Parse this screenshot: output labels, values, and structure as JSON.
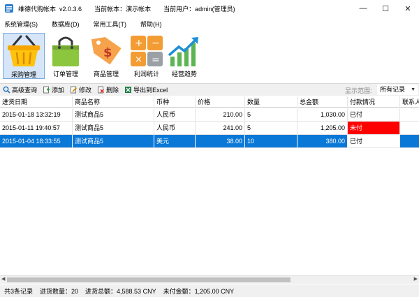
{
  "window": {
    "app_name": "维德代购帐本",
    "version": "v2.0.3.6",
    "current_book": "当前帐本：演示帐本",
    "current_user": "当前用户：admin(管理员)",
    "minimize": "—",
    "maximize": "☐",
    "close": "✕"
  },
  "menu": [
    "系统管理(S)",
    "数据库(D)",
    "常用工具(T)",
    "帮助(H)"
  ],
  "toolbar": [
    {
      "label": "采购管理",
      "icon": "shopping-basket-icon",
      "active": true
    },
    {
      "label": "订单管理",
      "icon": "shopping-bag-icon",
      "active": false
    },
    {
      "label": "商品管理",
      "icon": "price-tag-icon",
      "active": false
    },
    {
      "label": "利润统计",
      "icon": "calculator-icon",
      "active": false
    },
    {
      "label": "经营趋势",
      "icon": "trend-chart-icon",
      "active": false
    }
  ],
  "actions": {
    "search": "高级查询",
    "add": "添加",
    "edit": "修改",
    "delete": "删除",
    "export": "导出到Excel"
  },
  "range": {
    "label": "显示范围:",
    "value": "所有记录"
  },
  "table": {
    "columns": [
      "进货日期",
      "商品名称",
      "币种",
      "价格",
      "数量",
      "总金额",
      "付款情况",
      "联系人"
    ],
    "rows": [
      {
        "date": "2015-01-18 13:32:19",
        "product": "测试商品5",
        "currency": "人民币",
        "price": "210.00",
        "qty": "5",
        "total": "1,030.00",
        "payment": "已付",
        "selected": false,
        "unpaid": false
      },
      {
        "date": "2015-01-11 19:40:57",
        "product": "测试商品5",
        "currency": "人民币",
        "price": "241.00",
        "qty": "5",
        "total": "1,205.00",
        "payment": "未付",
        "selected": false,
        "unpaid": true
      },
      {
        "date": "2015-01-04 18:33:55",
        "product": "测试商品5",
        "currency": "美元",
        "price": "38.00",
        "qty": "10",
        "total": "380.00",
        "payment": "已付",
        "selected": true,
        "unpaid": false
      }
    ]
  },
  "status": {
    "count": "共3条记录",
    "qty": "进货数量：20",
    "total": "进货总额：4,588.53 CNY",
    "unpaid": "未付金额：1,205.00 CNY"
  },
  "colors": {
    "accent": "#0a78d7",
    "unpaid": "#ff0000"
  }
}
